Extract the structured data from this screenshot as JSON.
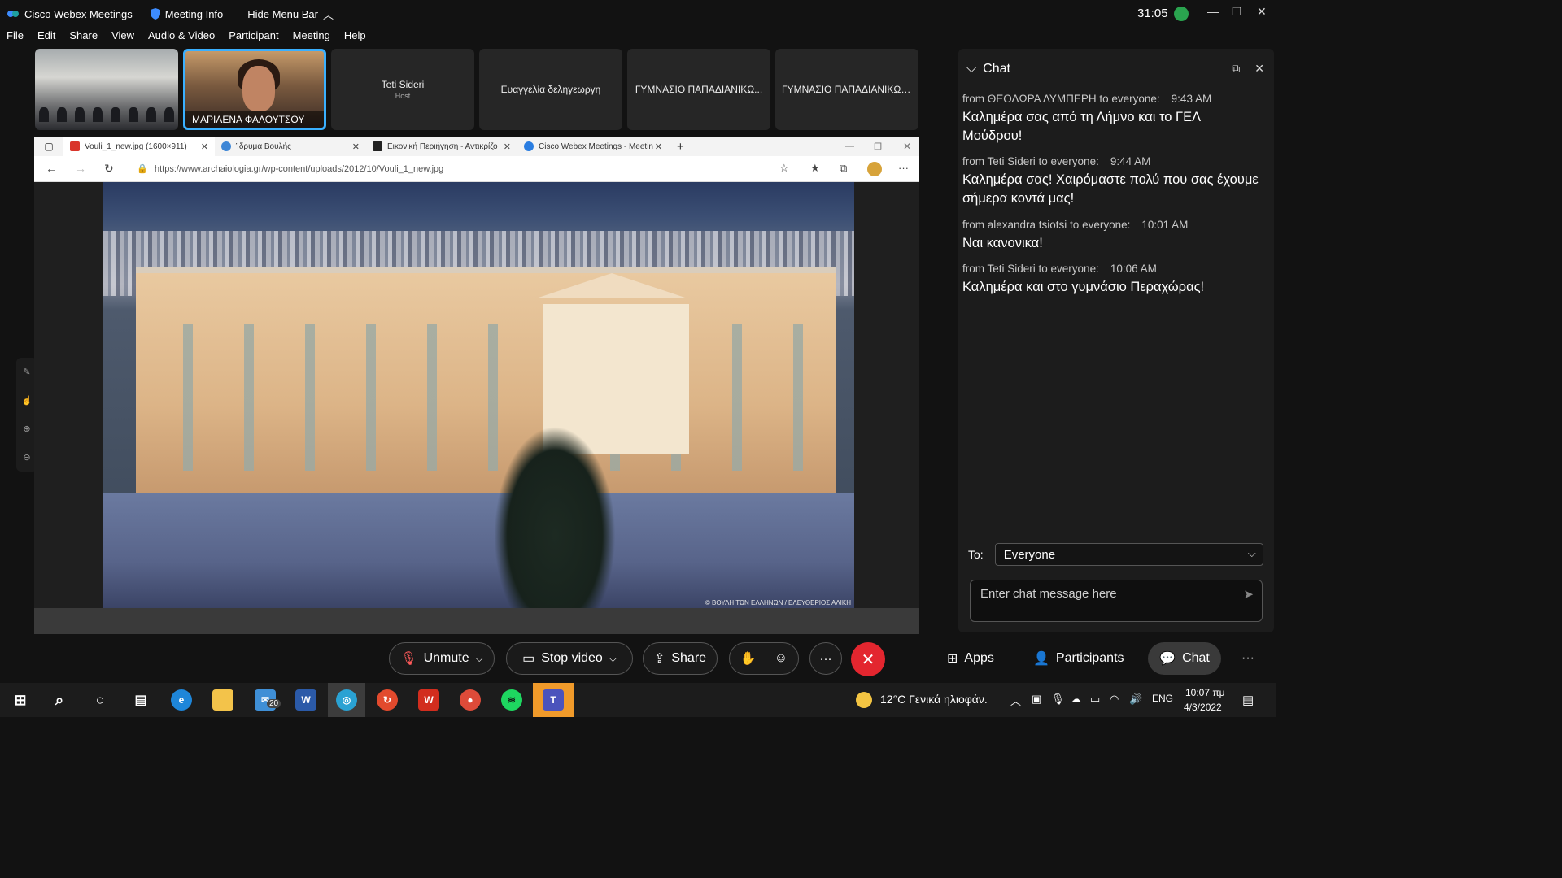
{
  "titlebar": {
    "app_name": "Cisco Webex Meetings",
    "meeting_info": "Meeting Info",
    "hide_menu": "Hide Menu Bar",
    "timer": "31:05"
  },
  "menu": [
    "File",
    "Edit",
    "Share",
    "View",
    "Audio & Video",
    "Participant",
    "Meeting",
    "Help"
  ],
  "participants": [
    {
      "name": "",
      "role": ""
    },
    {
      "name": "ΜΑΡΙΛΕΝΑ ΦΑΛΟΥΤΣΟΥ",
      "role": ""
    },
    {
      "name": "Teti Sideri",
      "role": "Host"
    },
    {
      "name": "Ευαγγελία δεληγεωργη",
      "role": ""
    },
    {
      "name": "ΓΥΜΝΑΣΙΟ ΠΑΠΑΔΙΑΝΙΚΩ...",
      "role": ""
    },
    {
      "name": "ΓΥΜΝΑΣΙΟ ΠΑΠΑΔΙΑΝΙΚΩΝ...",
      "role": ""
    }
  ],
  "browser": {
    "tabs": [
      {
        "title": "Vouli_1_new.jpg (1600×911)",
        "active": true,
        "icon_color": "#d9352b"
      },
      {
        "title": "Ίδρυμα Βουλής",
        "active": false,
        "icon_color": "#3d86d6"
      },
      {
        "title": "Εικονική Περιήγηση - Αντικρίζο",
        "active": false,
        "icon_color": "#222222"
      },
      {
        "title": "Cisco Webex Meetings - Meetin",
        "active": false,
        "icon_color": "#2a7de1"
      }
    ],
    "url": "https://www.archaiologia.gr/wp-content/uploads/2012/10/Vouli_1_new.jpg"
  },
  "photo": {
    "credit": "© ΒΟΥΛΗ ΤΩΝ ΕΛΛΗΝΩΝ / ΕΛΕΥΘΕΡΙΟΣ ΑΛΙΚΗ"
  },
  "chat": {
    "title": "Chat",
    "messages": [
      {
        "meta": "from ΘΕΟΔΩΡΑ ΛΥΜΠΕΡΗ to everyone:",
        "time": "9:43 AM",
        "body": "Καλημέρα σας από τη Λήμνο και το ΓΕΛ Μούδρου!"
      },
      {
        "meta": "from Teti Sideri to everyone:",
        "time": "9:44 AM",
        "body": "Καλημέρα σας! Χαιρόμαστε πολύ που σας έχουμε σήμερα κοντά μας!"
      },
      {
        "meta": "from alexandra tsiotsi to everyone:",
        "time": "10:01 AM",
        "body": "Ναι κανονικα!"
      },
      {
        "meta": "from Teti Sideri to everyone:",
        "time": "10:06 AM",
        "body": "Καλημέρα και στο γυμνάσιο Περαχώρας!"
      }
    ],
    "to_label": "To:",
    "to_value": "Everyone",
    "placeholder": "Enter chat message here"
  },
  "controls": {
    "unmute": "Unmute",
    "stop_video": "Stop video",
    "share": "Share",
    "apps": "Apps",
    "participants": "Participants",
    "chat": "Chat"
  },
  "taskbar": {
    "mail_badge": "20",
    "weather": "12°C  Γενικά ηλιοφάν.",
    "lang": "ENG",
    "time": "10:07 πμ",
    "date": "4/3/2022"
  }
}
